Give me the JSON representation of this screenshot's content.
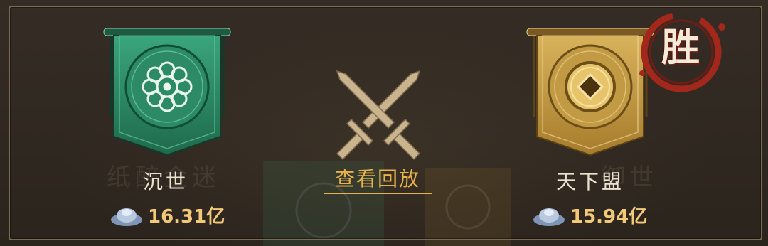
{
  "left_team": {
    "name": "沉世",
    "power": "16.31亿",
    "banner_color": "#2f8f6a",
    "emblem_icon": "flower-emblem-icon",
    "currency_icon": "silver-ingot-icon"
  },
  "right_team": {
    "name": "天下盟",
    "power": "15.94亿",
    "banner_color": "#c9a04a",
    "emblem_icon": "coin-emblem-icon",
    "currency_icon": "silver-ingot-icon",
    "result": "胜"
  },
  "center": {
    "replay_label": "查看回放",
    "vs_icon": "crossed-swords-icon"
  },
  "colors": {
    "accent_gold": "#e8b24a",
    "power_text": "#f2c879",
    "win_red": "#a3271b"
  }
}
